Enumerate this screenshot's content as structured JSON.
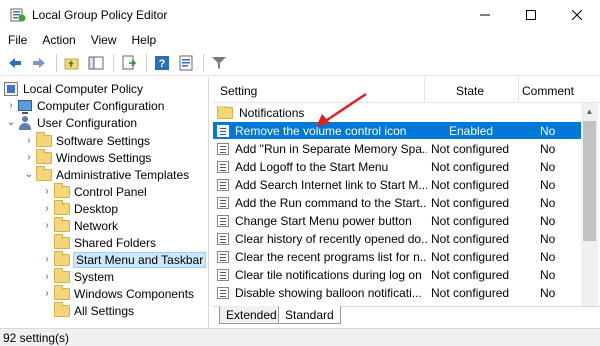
{
  "window": {
    "title": "Local Group Policy Editor",
    "app_icon": "group-policy-icon",
    "controls": [
      "minimize",
      "maximize",
      "close"
    ]
  },
  "menu": [
    "File",
    "Action",
    "View",
    "Help"
  ],
  "toolbar": {
    "buttons": [
      "back-icon",
      "forward-icon",
      "up-folder-icon",
      "show-hide-tree-icon",
      "export-list-icon",
      "help-icon",
      "properties-icon",
      "filter-icon"
    ]
  },
  "tree": {
    "root": "Local Computer Policy",
    "computer_configuration": "Computer Configuration",
    "user_configuration": "User Configuration",
    "software_settings": "Software Settings",
    "windows_settings": "Windows Settings",
    "administrative_templates": "Administrative Templates",
    "control_panel": "Control Panel",
    "desktop": "Desktop",
    "network": "Network",
    "shared_folders": "Shared Folders",
    "start_menu_taskbar": "Start Menu and Taskbar",
    "system": "System",
    "windows_components": "Windows Components",
    "all_settings": "All Settings"
  },
  "list": {
    "columns": {
      "setting": "Setting",
      "state": "State",
      "comment": "Comment"
    },
    "folder": "Notifications",
    "rows": [
      {
        "setting": "Remove the volume control icon",
        "state": "Enabled",
        "comment": "No"
      },
      {
        "setting": "Add \"Run in Separate Memory Spa...",
        "state": "Not configured",
        "comment": "No"
      },
      {
        "setting": "Add Logoff to the Start Menu",
        "state": "Not configured",
        "comment": "No"
      },
      {
        "setting": "Add Search Internet link to Start M...",
        "state": "Not configured",
        "comment": "No"
      },
      {
        "setting": "Add the Run command to the Start...",
        "state": "Not configured",
        "comment": "No"
      },
      {
        "setting": "Change Start Menu power button",
        "state": "Not configured",
        "comment": "No"
      },
      {
        "setting": "Clear history of recently opened do...",
        "state": "Not configured",
        "comment": "No"
      },
      {
        "setting": "Clear the recent programs list for n...",
        "state": "Not configured",
        "comment": "No"
      },
      {
        "setting": "Clear tile notifications during log on",
        "state": "Not configured",
        "comment": "No"
      },
      {
        "setting": "Disable showing balloon notificati...",
        "state": "Not configured",
        "comment": "No"
      }
    ]
  },
  "tabs": [
    "Extended",
    "Standard"
  ],
  "status": "92 setting(s)",
  "colors": {
    "selection": "#0078d7",
    "tree_selection": "#cce8ff",
    "annotation_arrow": "#e02020"
  }
}
